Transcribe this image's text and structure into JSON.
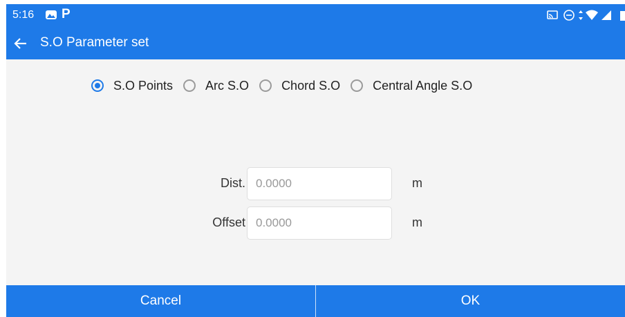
{
  "status_bar": {
    "time": "5:16",
    "left_icons": [
      "gallery-icon",
      "p-icon"
    ],
    "p_glyph": "P",
    "right_icons": [
      "cast-icon",
      "do-not-disturb-icon",
      "data-arrows-icon",
      "wifi-icon",
      "signal-icon",
      "battery-icon"
    ]
  },
  "app_bar": {
    "title": "S.O Parameter set",
    "back_icon": "arrow-left-icon"
  },
  "stakeout_types": [
    {
      "label": "S.O Points",
      "selected": true
    },
    {
      "label": "Arc S.O",
      "selected": false
    },
    {
      "label": "Chord S.O",
      "selected": false
    },
    {
      "label": "Central Angle S.O",
      "selected": false
    }
  ],
  "fields": {
    "dist": {
      "label": "Dist.",
      "value": "",
      "placeholder": "0.0000",
      "unit": "m"
    },
    "offset": {
      "label": "Offset",
      "value": "",
      "placeholder": "0.0000",
      "unit": "m"
    }
  },
  "buttons": {
    "cancel": "Cancel",
    "ok": "OK"
  },
  "colors": {
    "accent": "#1e7ae8",
    "background": "#f4f4f4"
  }
}
